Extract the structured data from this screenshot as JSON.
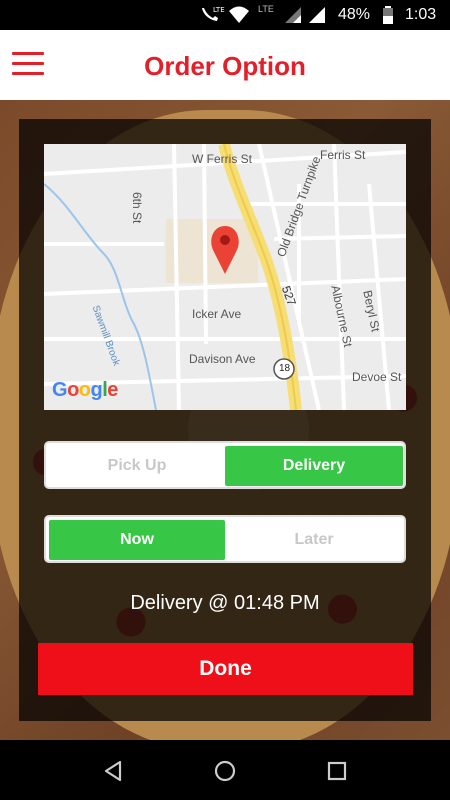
{
  "status_bar": {
    "network": "LTE",
    "battery": "48%",
    "time": "1:03"
  },
  "header": {
    "title": "Order Option",
    "menu_icon": "hamburger-menu-icon"
  },
  "map": {
    "streets": [
      "W Ferris St",
      "Ferris St",
      "6th St",
      "Old Bridge Turnpike",
      "527",
      "Albourne St",
      "Beryl St",
      "Icker Ave",
      "Davison Ave",
      "18",
      "Devoe St",
      "Sawmill Brook"
    ],
    "logo": "Google",
    "marker_icon": "map-pin-icon"
  },
  "order_type": {
    "options": [
      "Pick Up",
      "Delivery"
    ],
    "selected": "Delivery"
  },
  "timing": {
    "options": [
      "Now",
      "Later"
    ],
    "selected": "Now"
  },
  "delivery_time_text": "Delivery @ 01:48 PM",
  "done_label": "Done",
  "colors": {
    "accent_red": "#e3202a",
    "button_red": "#ee0f18",
    "active_green": "#38c646"
  },
  "nav": {
    "back_icon": "back-triangle-icon",
    "home_icon": "home-circle-icon",
    "recents_icon": "recents-square-icon"
  }
}
